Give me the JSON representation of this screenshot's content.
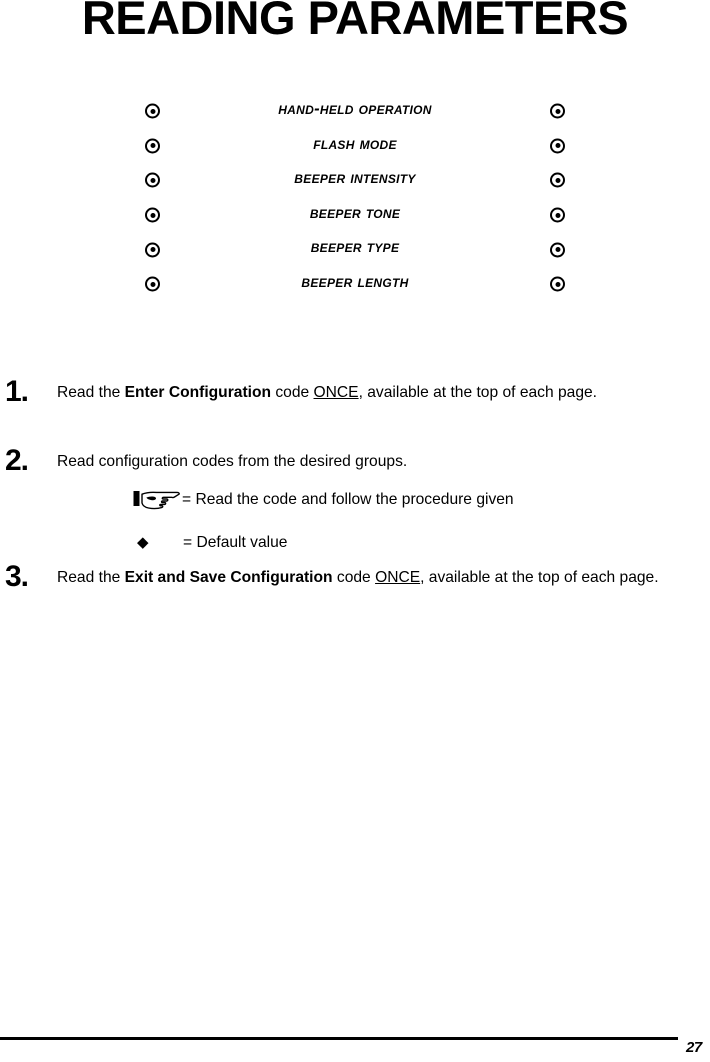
{
  "page": {
    "title": "READING PARAMETERS",
    "number": "27"
  },
  "parameters": {
    "bullet_icon": "circled-dot-icon",
    "items": [
      {
        "label": "Hand-Held Operation"
      },
      {
        "label": "Flash Mode"
      },
      {
        "label": "Beeper Intensity"
      },
      {
        "label": "Beeper Tone"
      },
      {
        "label": "Beeper Type"
      },
      {
        "label": "Beeper Length"
      }
    ]
  },
  "steps": [
    {
      "number": "1.",
      "text_parts": {
        "lead": "Read the ",
        "bold": "Enter Configuration",
        "mid": " code ",
        "underline": "ONCE",
        "tail": ", available at the top of each page."
      }
    },
    {
      "number": "2.",
      "text_parts": {
        "lead": "Read configuration codes from the desired groups.",
        "bold": "",
        "mid": "",
        "underline": "",
        "tail": ""
      }
    },
    {
      "number": "3.",
      "text_parts": {
        "lead": "Read the ",
        "bold": "Exit and Save Configuration",
        "mid": " code ",
        "underline": "ONCE",
        "tail": ", available at the top of each page."
      }
    }
  ],
  "legend": [
    {
      "icon": "pointing-hand-icon",
      "glyph": "",
      "text": "= Read the code and follow the procedure given"
    },
    {
      "icon": "black-diamond-icon",
      "glyph": "◆",
      "text": "= Default value"
    }
  ]
}
